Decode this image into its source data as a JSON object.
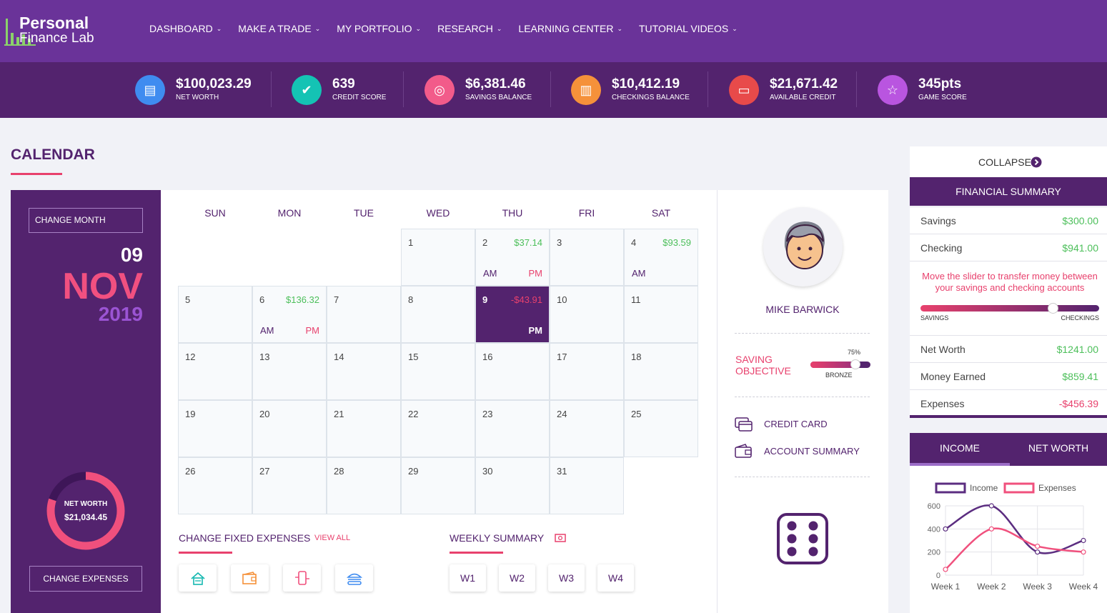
{
  "brand": {
    "line1": "Personal",
    "line2": "Finance Lab"
  },
  "nav": [
    {
      "label": "DASHBOARD"
    },
    {
      "label": "MAKE A TRADE"
    },
    {
      "label": "MY PORTFOLIO"
    },
    {
      "label": "RESEARCH"
    },
    {
      "label": "LEARNING CENTER"
    },
    {
      "label": "TUTORIAL VIDEOS"
    }
  ],
  "stats": [
    {
      "value": "$100,023.29",
      "label": "NET WORTH",
      "color": "#3f8cf0",
      "icon": "wallet-icon"
    },
    {
      "value": "639",
      "label": "CREDIT SCORE",
      "color": "#14c3b4",
      "icon": "badge-check-icon"
    },
    {
      "value": "$6,381.46",
      "label": "SAVINGS BALANCE",
      "color": "#f25b8a",
      "icon": "coins-icon"
    },
    {
      "value": "$10,412.19",
      "label": "CHECKINGS BALANCE",
      "color": "#f5913a",
      "icon": "cash-stack-icon"
    },
    {
      "value": "$21,671.42",
      "label": "AVAILABLE CREDIT",
      "color": "#e84a4a",
      "icon": "credit-card-icon"
    },
    {
      "value": "345pts",
      "label": "GAME SCORE",
      "color": "#b955e0",
      "icon": "star-icon"
    }
  ],
  "calendar": {
    "title": "CALENDAR",
    "change_month": "CHANGE MONTH",
    "day": "09",
    "month": "NOV",
    "year": "2019",
    "net_worth_label": "NET WORTH",
    "net_worth_value": "$21,034.45",
    "net_worth_ring_fraction": 0.8,
    "change_expenses": "CHANGE EXPENSES",
    "weekdays": [
      "SUN",
      "MON",
      "TUE",
      "WED",
      "THU",
      "FRI",
      "SAT"
    ],
    "days": [
      {
        "d": "1"
      },
      {
        "d": "2",
        "amt": "$37.14",
        "am": "AM",
        "pm": "PM"
      },
      {
        "d": "3"
      },
      {
        "d": "4",
        "amt": "$93.59",
        "am": "AM"
      },
      {
        "d": "5"
      },
      {
        "d": "6",
        "amt": "$136.32",
        "am": "AM",
        "pm": "PM"
      },
      {
        "d": "7"
      },
      {
        "d": "8"
      },
      {
        "d": "9",
        "amt": "-$43.91",
        "pm": "PM",
        "today": true
      },
      {
        "d": "10"
      },
      {
        "d": "11"
      },
      {
        "d": "12"
      },
      {
        "d": "13"
      },
      {
        "d": "14"
      },
      {
        "d": "15"
      },
      {
        "d": "16"
      },
      {
        "d": "17"
      },
      {
        "d": "18"
      },
      {
        "d": "19"
      },
      {
        "d": "20"
      },
      {
        "d": "21"
      },
      {
        "d": "22"
      },
      {
        "d": "23"
      },
      {
        "d": "24"
      },
      {
        "d": "25"
      },
      {
        "d": "26"
      },
      {
        "d": "27"
      },
      {
        "d": "28"
      },
      {
        "d": "29"
      },
      {
        "d": "30"
      },
      {
        "d": "31"
      }
    ],
    "fixed_expenses_title": "CHANGE FIXED EXPENSES",
    "view_all": "VIEW ALL",
    "fixed_expense_icons": [
      "house-icon",
      "wallet-icon",
      "phone-icon",
      "burger-icon"
    ],
    "weekly_summary_title": "WEEKLY SUMMARY",
    "weeks": [
      "W1",
      "W2",
      "W3",
      "W4"
    ]
  },
  "profile": {
    "name": "MIKE BARWICK",
    "saving_objective": "SAVING OBJECTIVE",
    "objective_percent": "75%",
    "objective_level": "BRONZE",
    "links": [
      "CREDIT CARD",
      "ACCOUNT SUMMARY"
    ]
  },
  "summary": {
    "collapse": "COLLAPSE",
    "title": "FINANCIAL SUMMARY",
    "savings_label": "Savings",
    "savings": "$300.00",
    "checking_label": "Checking",
    "checking": "$941.00",
    "slider_text": "Move the slider to transfer money between your savings and checking accounts",
    "slider_left": "SAVINGS",
    "slider_right": "CHECKINGS",
    "slider_fraction": 0.74,
    "net_worth_label": "Net Worth",
    "net_worth": "$1241.00",
    "money_earned_label": "Money Earned",
    "money_earned": "$859.41",
    "expenses_label": "Expenses",
    "expenses": "-$456.39"
  },
  "chart_tabs": [
    "INCOME",
    "NET WORTH"
  ],
  "chart_data": {
    "type": "line",
    "categories": [
      "Week 1",
      "Week 2",
      "Week 3",
      "Week 4"
    ],
    "series": [
      {
        "name": "Income",
        "values": [
          400,
          600,
          200,
          300
        ],
        "color": "#5b2d80"
      },
      {
        "name": "Expenses",
        "values": [
          50,
          400,
          250,
          200
        ],
        "color": "#f0507d"
      }
    ],
    "ylim": [
      0,
      600
    ],
    "yticks": [
      "0",
      "200",
      "400",
      "600"
    ],
    "grid": true,
    "legend": "top"
  }
}
